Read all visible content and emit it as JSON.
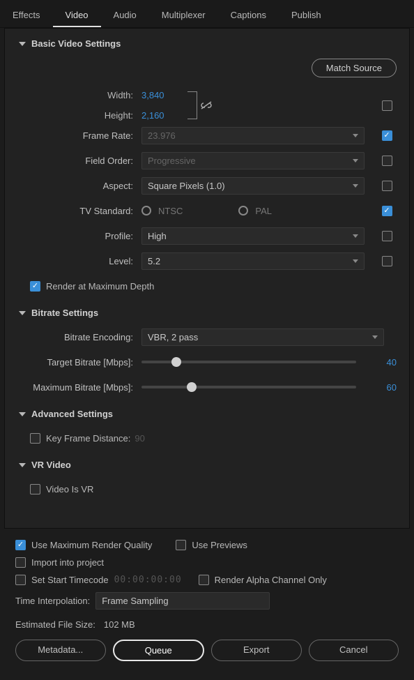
{
  "tabs": [
    "Effects",
    "Video",
    "Audio",
    "Multiplexer",
    "Captions",
    "Publish"
  ],
  "active_tab": 1,
  "basic_video": {
    "title": "Basic Video Settings",
    "match_source": "Match Source",
    "width_label": "Width:",
    "width_value": "3,840",
    "height_label": "Height:",
    "height_value": "2,160",
    "frame_rate_label": "Frame Rate:",
    "frame_rate_value": "23.976",
    "field_order_label": "Field Order:",
    "field_order_value": "Progressive",
    "aspect_label": "Aspect:",
    "aspect_value": "Square Pixels (1.0)",
    "tv_standard_label": "TV Standard:",
    "ntsc_label": "NTSC",
    "pal_label": "PAL",
    "profile_label": "Profile:",
    "profile_value": "High",
    "level_label": "Level:",
    "level_value": "5.2",
    "render_max_depth": "Render at Maximum Depth"
  },
  "bitrate": {
    "title": "Bitrate Settings",
    "encoding_label": "Bitrate Encoding:",
    "encoding_value": "VBR, 2 pass",
    "target_label": "Target Bitrate [Mbps]:",
    "target_value": "40",
    "max_label": "Maximum Bitrate [Mbps]:",
    "max_value": "60"
  },
  "advanced": {
    "title": "Advanced Settings",
    "keyframe_label": "Key Frame Distance:",
    "keyframe_value": "90"
  },
  "vr": {
    "title": "VR Video",
    "is_vr_label": "Video Is VR"
  },
  "footer": {
    "use_max_quality": "Use Maximum Render Quality",
    "use_previews": "Use Previews",
    "import_project": "Import into project",
    "set_start_tc": "Set Start Timecode",
    "tc_value": "00:00:00:00",
    "render_alpha": "Render Alpha Channel Only",
    "time_interp_label": "Time Interpolation:",
    "time_interp_value": "Frame Sampling",
    "est_size_label": "Estimated File Size:",
    "est_size_value": "102 MB",
    "metadata_btn": "Metadata...",
    "queue_btn": "Queue",
    "export_btn": "Export",
    "cancel_btn": "Cancel"
  }
}
